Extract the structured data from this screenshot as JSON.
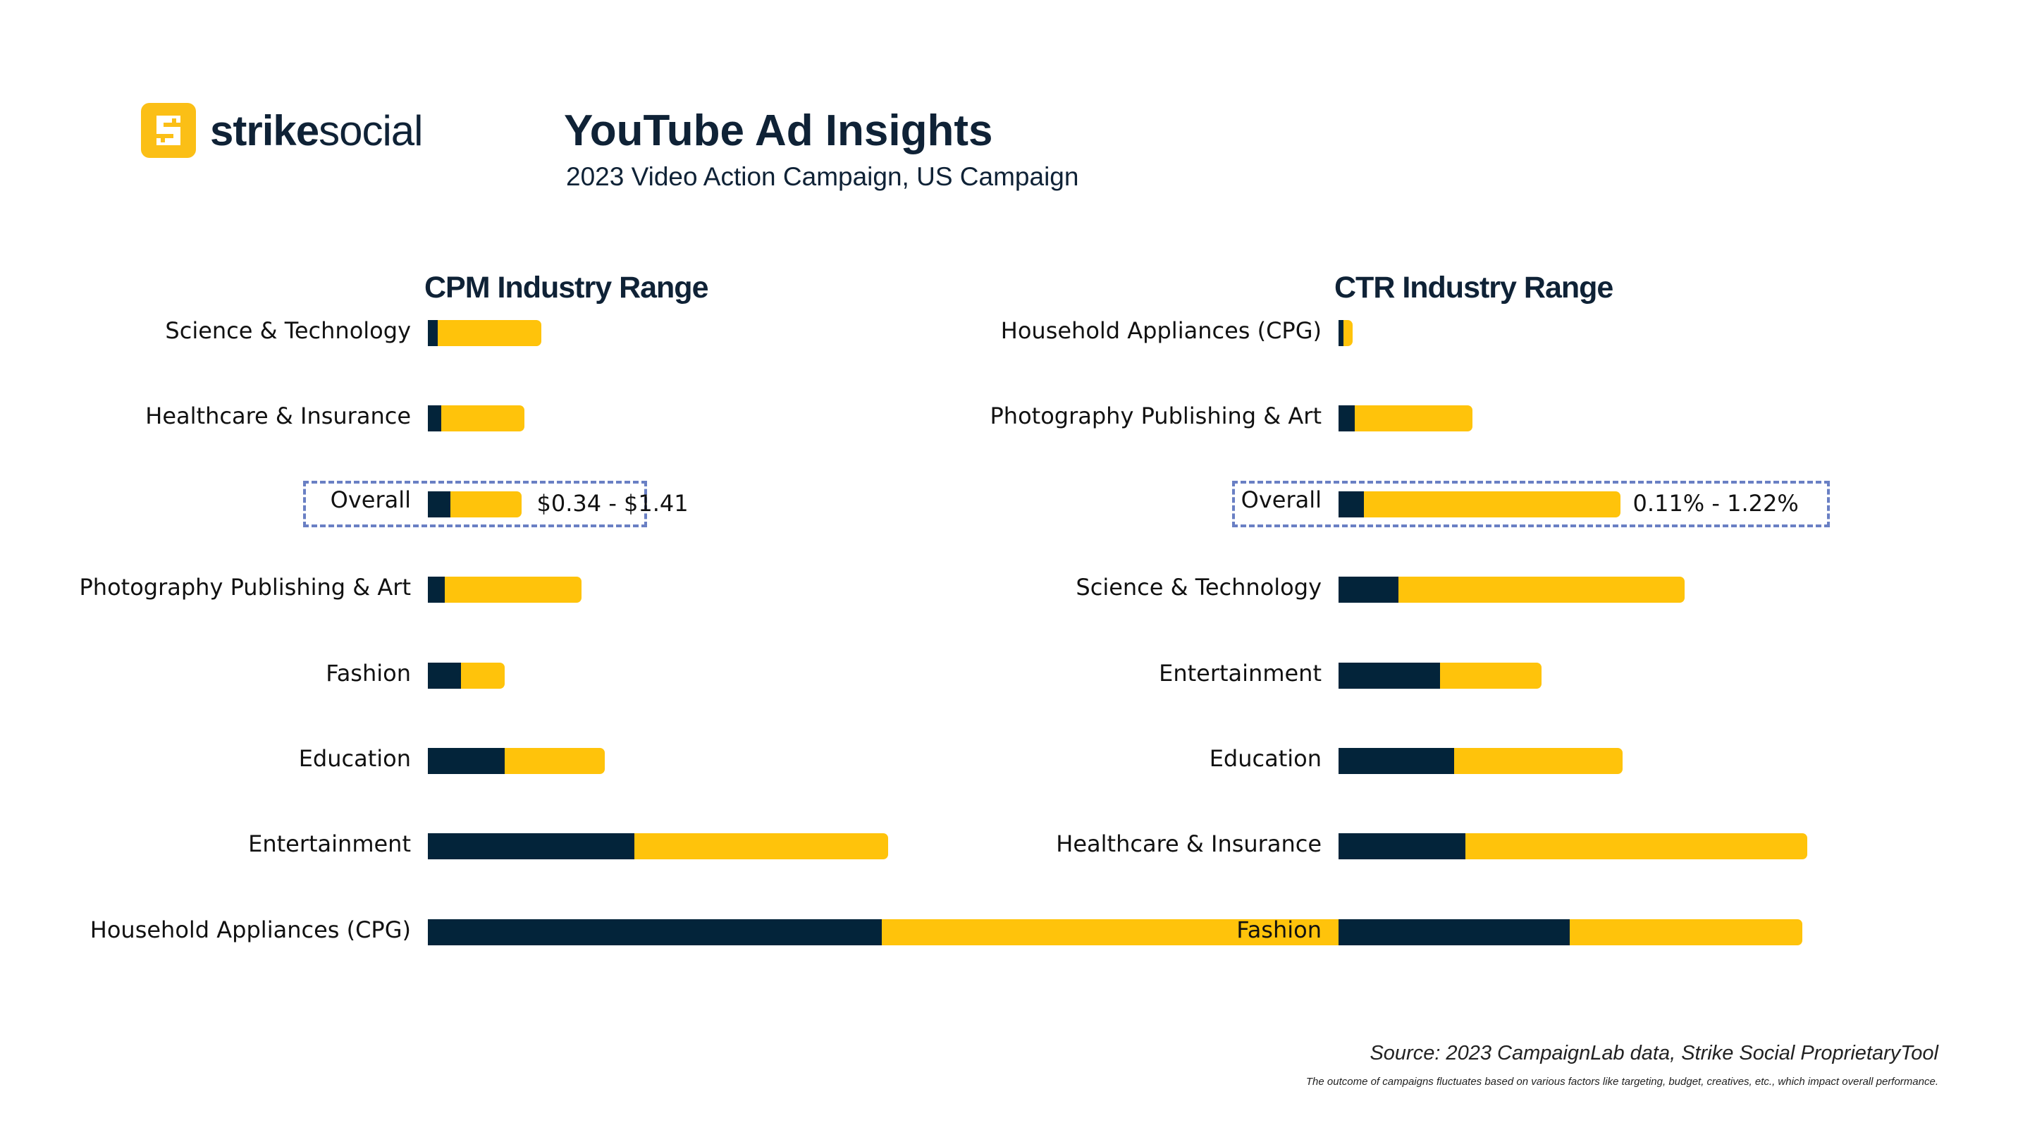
{
  "brand": {
    "bold": "strike",
    "light": "social",
    "color_primary": "#ffc30b",
    "color_dark": "#03243a"
  },
  "header": {
    "title": "YouTube Ad Insights",
    "subtitle": "2023 Video Action Campaign, US Campaign"
  },
  "footer": {
    "source": "Source: 2023 CampaignLab data, Strike Social ProprietaryTool",
    "disclaimer": "The outcome of campaigns fluctuates based on various factors like targeting, budget, creatives, etc., which impact overall performance."
  },
  "chart_data": [
    {
      "type": "bar",
      "orientation": "horizontal-range",
      "title": "CPM Industry Range",
      "unit": "USD",
      "categories": [
        "Science & Technology",
        "Healthcare & Insurance",
        "Overall",
        "Photography Publishing & Art",
        "Fashion",
        "Education",
        "Entertainment",
        "Household Appliances (CPG)"
      ],
      "series": [
        {
          "name": "min",
          "color": "#03243a",
          "values": [
            0.15,
            0.2,
            0.34,
            0.25,
            0.5,
            1.16,
            3.12,
            6.85
          ]
        },
        {
          "name": "max",
          "color": "#ffc30b",
          "values": [
            1.71,
            1.46,
            1.41,
            2.32,
            1.16,
            2.67,
            6.95,
            16.53
          ]
        }
      ],
      "highlight": {
        "category": "Overall",
        "label": "$0.34 - $1.41"
      },
      "xlim": [
        0,
        17
      ],
      "grid": false,
      "legend": "none"
    },
    {
      "type": "bar",
      "orientation": "horizontal-range",
      "title": "CTR Industry Range",
      "unit": "%",
      "categories": [
        "Household Appliances (CPG)",
        "Photography Publishing & Art",
        "Overall",
        "Science & Technology",
        "Entertainment",
        "Education",
        "Healthcare & Insurance",
        "Fashion"
      ],
      "series": [
        {
          "name": "min",
          "color": "#03243a",
          "values": [
            0.02,
            0.07,
            0.11,
            0.26,
            0.44,
            0.5,
            0.55,
            1.0
          ]
        },
        {
          "name": "max",
          "color": "#ffc30b",
          "values": [
            0.06,
            0.58,
            1.22,
            1.5,
            0.88,
            1.23,
            2.03,
            2.01
          ]
        }
      ],
      "highlight": {
        "category": "Overall",
        "label": "0.11% - 1.22%"
      },
      "xlim": [
        0,
        2.1
      ],
      "grid": false,
      "legend": "none"
    }
  ]
}
